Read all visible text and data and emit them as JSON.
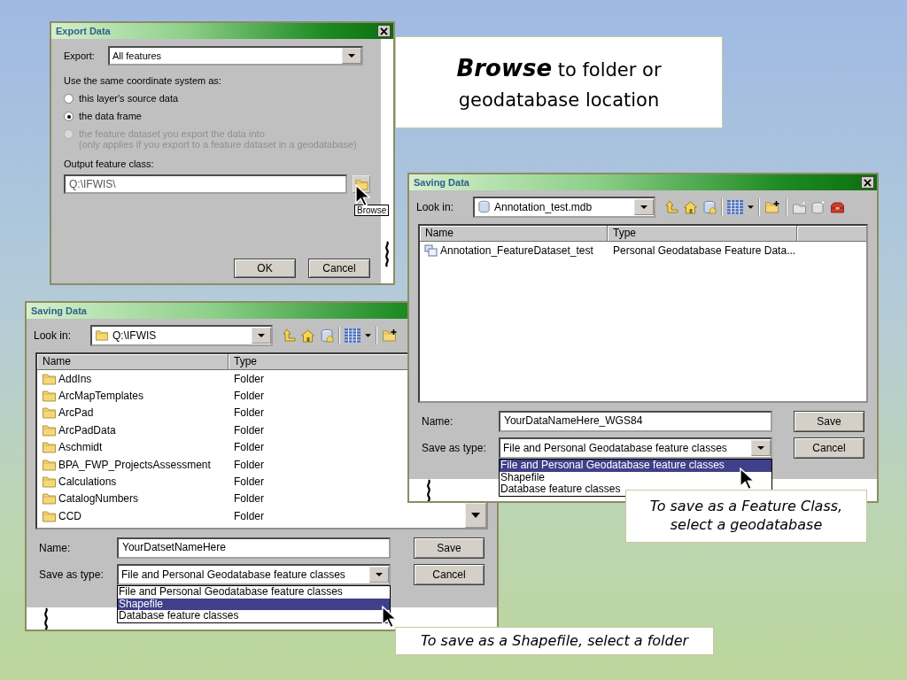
{
  "export_dialog": {
    "title": "Export Data",
    "export_label": "Export:",
    "export_value": "All features",
    "coord_label": "Use the same coordinate system as:",
    "options": [
      {
        "label": "this layer's source data",
        "selected": false,
        "disabled": false
      },
      {
        "label": "the data frame",
        "selected": true,
        "disabled": false
      },
      {
        "label": "the feature dataset you export the data into",
        "note": "(only applies if you export to a feature dataset in a geodatabase)",
        "selected": false,
        "disabled": true
      }
    ],
    "output_label": "Output feature class:",
    "output_value": "Q:\\IFWIS\\",
    "browse_tooltip": "Browse",
    "buttons": [
      "OK",
      "Cancel"
    ]
  },
  "callouts": [
    {
      "kind": "heading",
      "text": "**Browse** to folder or geodatabase location"
    },
    {
      "kind": "note",
      "text": "To save as a Feature Class, select a geodatabase"
    },
    {
      "kind": "note",
      "text": "To save as a Shapefile, select a folder"
    }
  ],
  "saving_dialogs": [
    {
      "title": "Saving Data",
      "look_in": {
        "kind": "database",
        "label": "Look in:",
        "value": "Annotation_test.mdb"
      },
      "columns": [
        "Name",
        "Type"
      ],
      "rows": [
        {
          "kind": "feature_dataset",
          "name": "Annotation_FeatureDataset_test",
          "type": "Personal Geodatabase Feature Data..."
        }
      ],
      "name_label": "Name:",
      "name_value": "YourDataNameHere_WGS84",
      "type_label": "Save as type:",
      "type_value": "File and Personal Geodatabase feature classes",
      "type_options": [
        {
          "label": "File and Personal Geodatabase feature classes",
          "selected": true
        },
        {
          "label": "Shapefile",
          "selected": false
        },
        {
          "label": "Database feature classes",
          "selected": false
        }
      ],
      "buttons": [
        "Save",
        "Cancel"
      ]
    },
    {
      "title": "Saving Data",
      "look_in": {
        "kind": "folder",
        "label": "Look in:",
        "value": "Q:\\IFWIS"
      },
      "columns": [
        "Name",
        "Type"
      ],
      "rows": [
        {
          "kind": "folder",
          "name": "AddIns",
          "type": "Folder"
        },
        {
          "kind": "folder",
          "name": "ArcMapTemplates",
          "type": "Folder"
        },
        {
          "kind": "folder",
          "name": "ArcPad",
          "type": "Folder"
        },
        {
          "kind": "folder",
          "name": "ArcPadData",
          "type": "Folder"
        },
        {
          "kind": "folder",
          "name": "Aschmidt",
          "type": "Folder"
        },
        {
          "kind": "folder",
          "name": "BPA_FWP_ProjectsAssessment",
          "type": "Folder"
        },
        {
          "kind": "folder",
          "name": "Calculations",
          "type": "Folder"
        },
        {
          "kind": "folder",
          "name": "CatalogNumbers",
          "type": "Folder"
        },
        {
          "kind": "folder",
          "name": "CCD",
          "type": "Folder"
        }
      ],
      "name_label": "Name:",
      "name_value": "YourDatsetNameHere",
      "type_label": "Save as type:",
      "type_value": "File and Personal Geodatabase feature classes",
      "type_options": [
        {
          "label": "File and Personal Geodatabase feature classes",
          "selected": false
        },
        {
          "label": "Shapefile",
          "selected": true
        },
        {
          "label": "Database feature classes",
          "selected": false
        }
      ],
      "buttons": [
        "Save",
        "Cancel"
      ]
    }
  ]
}
